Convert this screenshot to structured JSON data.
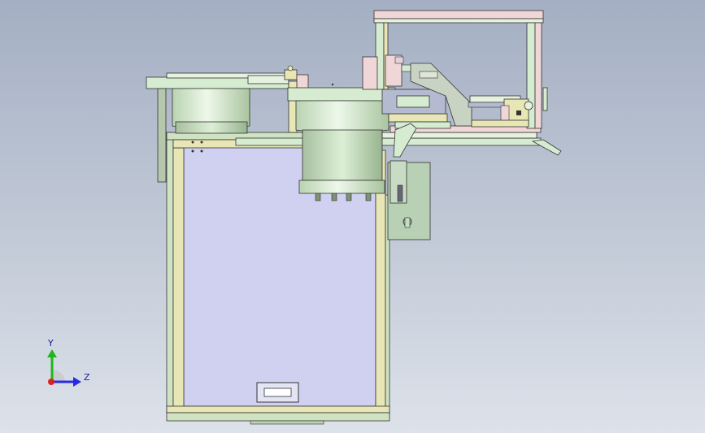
{
  "view": {
    "axis_x_label": "Z",
    "axis_y_label": "Y"
  },
  "colors": {
    "background_top": "#a4afc3",
    "background_bottom": "#dde2ea",
    "frame_green": "#cfe3c2",
    "frame_yellow": "#e8e6b4",
    "panel_lavender": "#d0d1f1",
    "bowl_green": "#d6ecd0",
    "frame_pink": "#f0d6d6",
    "outline": "#333333"
  },
  "icons": [
    "view-triad-icon"
  ]
}
